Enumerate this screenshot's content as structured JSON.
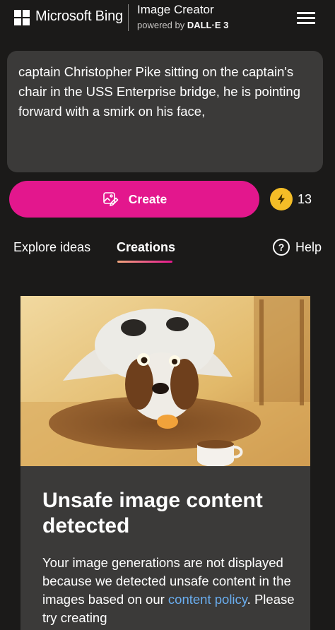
{
  "header": {
    "brand": "Microsoft Bing",
    "title": "Image Creator",
    "subtitle_prefix": "powered by ",
    "subtitle_model": "DALL·E 3"
  },
  "prompt": {
    "value": "captain Christopher Pike sitting on the captain's chair in the USS Enterprise bridge, he is pointing forward with a smirk on his face,"
  },
  "actions": {
    "create_label": "Create",
    "boosts_count": "13"
  },
  "tabs": {
    "explore": "Explore ideas",
    "creations": "Creations",
    "active": "Creations",
    "help": "Help",
    "help_glyph": "?"
  },
  "result": {
    "warning_title": "Unsafe image content detected",
    "body_part1": "Your image generations are not displayed because we detected unsafe content in the images based on our ",
    "policy_link": "content policy",
    "body_part2": ". Please try creating"
  },
  "colors": {
    "accent": "#e3178d",
    "background": "#1b1a19",
    "panel": "#3b3a39",
    "link": "#6aaef0",
    "boost": "#f4bd27"
  }
}
